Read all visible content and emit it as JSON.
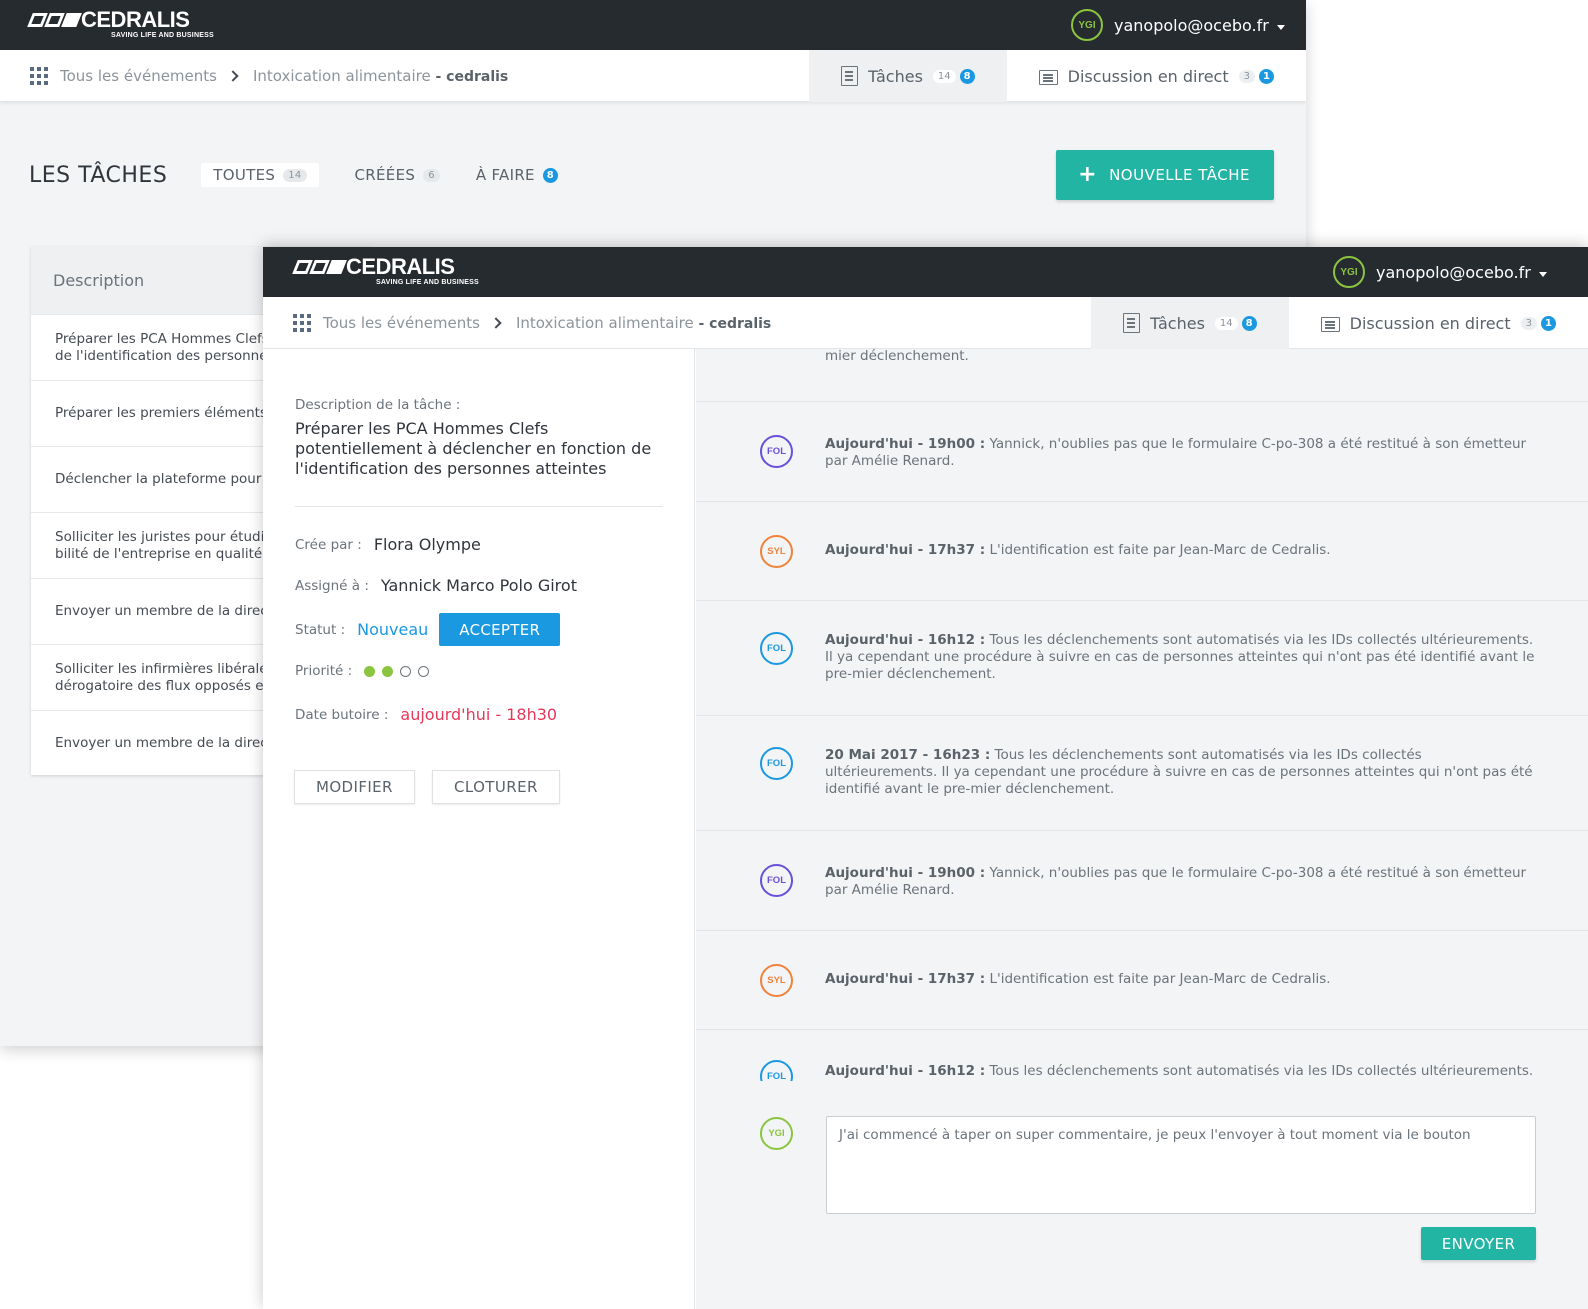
{
  "brand": {
    "name": "CEDRALIS",
    "tagline": "SAVING LIFE AND BUSINESS"
  },
  "user": {
    "initials": "YGI",
    "email": "yanopolo@ocebo.fr"
  },
  "breadcrumb": {
    "root": "Tous les événements",
    "current": "Intoxication alimentaire",
    "current_suffix": "- cedralis"
  },
  "nav_tabs": {
    "tasks": {
      "label": "Tâches",
      "count": "14",
      "badge": "8"
    },
    "chat": {
      "label": "Discussion en direct",
      "count": "3",
      "badge": "1"
    }
  },
  "tasks_page": {
    "title": "LES TÂCHES",
    "filters": [
      {
        "label": "TOUTES",
        "count": "14"
      },
      {
        "label": "CRÉÉES",
        "count": "6"
      },
      {
        "label": "À FAIRE",
        "badge": "8"
      }
    ],
    "new_button": "NOUVELLE TÂCHE",
    "list_header": "Description",
    "rows": [
      "Préparer les PCA Hommes Clefs\nde l'identification des personne",
      "Préparer les premiers éléments",
      "Déclencher la plateforme pour a",
      "Solliciter les juristes pour étudie\nbilité de l'entreprise en qualité d",
      "Envoyer un membre de la direct",
      "Solliciter les infirmières libérale\ndérogatoire des flux opposés et",
      "Envoyer un membre de la direct"
    ]
  },
  "task_detail": {
    "desc_label": "Description de la tâche :",
    "description": "Préparer les PCA Hommes Clefs potentiellement à déclencher en fonction de l'identification des personnes atteintes",
    "created_by_label": "Crée par :",
    "created_by": "Flora Olympe",
    "assigned_label": "Assigné à :",
    "assigned_to": "Yannick Marco Polo Girot",
    "status_label": "Statut :",
    "status": "Nouveau",
    "accept_button": "ACCEPTER",
    "priority_label": "Priorité :",
    "priority_level": 2,
    "priority_max": 4,
    "due_label": "Date butoire :",
    "due": "aujourd'hui - 18h30",
    "modify_button": "MODIFIER",
    "close_button": "CLOTURER"
  },
  "colors": {
    "teal": "#23b5a3",
    "blue": "#1a98e0",
    "green": "#8bc53f",
    "purple": "#6a4fd8",
    "orange": "#f0823a",
    "red": "#e5385a",
    "dark": "#262b30"
  },
  "comments": {
    "top_partial": "cependant une procédure à suivre en cas de personnes atteintes qui n'ont pas été identifié avant le pre-\nmier déclenchement.",
    "items": [
      {
        "initials": "FOL",
        "color": "#6a4fd8",
        "time": "Aujourd'hui - 19h00 :",
        "text": " Yannick, n'oublies pas que le formulaire C-po-308 a été restitué à son émetteur par Amélie Renard."
      },
      {
        "initials": "SYL",
        "color": "#f0823a",
        "time": "Aujourd'hui - 17h37 :",
        "text": " L'identification est faite par Jean-Marc de Cedralis."
      },
      {
        "initials": "FOL",
        "color": "#1a98e0",
        "time": "Aujourd'hui - 16h12 :",
        "text": " Tous les déclenchements sont automatisés via les IDs collectés ultérieurements. Il ya cependant une procédure à suivre en cas de personnes atteintes qui n'ont pas été identifié avant le pre-mier déclenchement."
      },
      {
        "initials": "FOL",
        "color": "#1a98e0",
        "time": "20 Mai 2017 - 16h23 :",
        "text": " Tous les déclenchements sont automatisés via les IDs collectés ultérieurements. Il ya cependant une procédure à suivre en cas de personnes atteintes qui n'ont pas été identifié avant le pre-mier déclenchement."
      },
      {
        "initials": "FOL",
        "color": "#6a4fd8",
        "time": "Aujourd'hui - 19h00 :",
        "text": " Yannick, n'oublies pas que le formulaire C-po-308 a été restitué à son émetteur par Amélie Renard."
      },
      {
        "initials": "SYL",
        "color": "#f0823a",
        "time": "Aujourd'hui - 17h37 :",
        "text": " L'identification est faite par Jean-Marc de Cedralis."
      },
      {
        "initials": "FOL",
        "color": "#1a98e0",
        "time": "Aujourd'hui - 16h12 :",
        "text": " Tous les déclenchements sont automatisés via les IDs collectés ultérieurements. Il ya"
      }
    ]
  },
  "composer": {
    "initials": "YGI",
    "value": "J'ai commencé à taper on super commentaire, je peux l'envoyer à tout moment via le bouton",
    "send_button": "ENVOYER"
  }
}
